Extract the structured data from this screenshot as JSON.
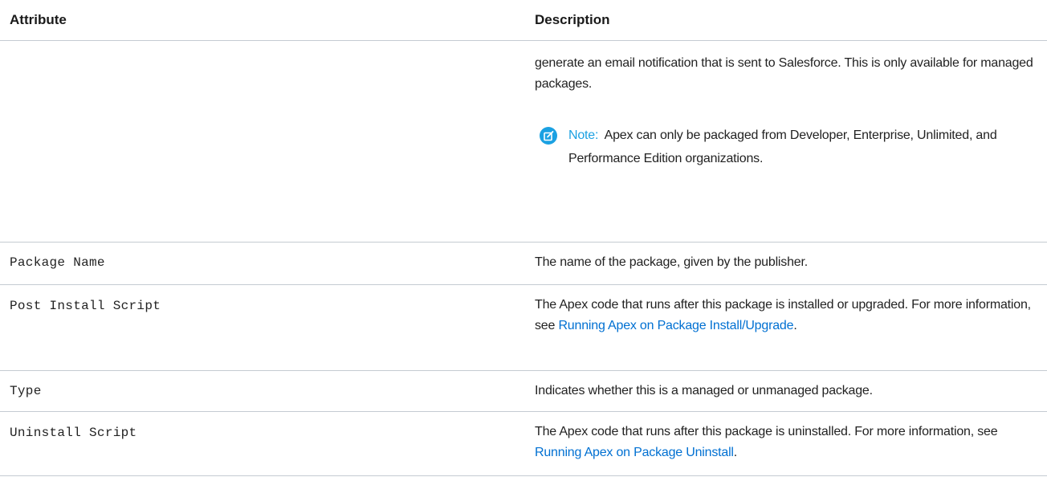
{
  "table": {
    "headers": {
      "attribute": "Attribute",
      "description": "Description"
    },
    "continued_row": {
      "description": "generate an email notification that is sent to Salesforce. This is only available for managed packages.",
      "note": {
        "icon": "edit-note-icon",
        "label": "Note:",
        "text": "Apex can only be packaged from Developer, Enterprise, Unlimited, and Performance Edition organizations."
      }
    },
    "rows": [
      {
        "attribute": "Package Name",
        "description": "The name of the package, given by the publisher."
      },
      {
        "attribute": "Post Install Script",
        "description_before": "The Apex code that runs after this package is installed or upgraded. For more information, see ",
        "link": "Running Apex on Package Install/Upgrade",
        "description_after": "."
      },
      {
        "attribute": "Type",
        "description": "Indicates whether this is a managed or unmanaged package."
      },
      {
        "attribute": "Uninstall Script",
        "description_before": "The Apex code that runs after this package is uninstalled. For more information, see ",
        "link": "Running Apex on Package Uninstall",
        "description_after": "."
      }
    ]
  },
  "colors": {
    "link": "#0070d2",
    "note_accent": "#1ba1e2",
    "divider": "#c5cbd2"
  }
}
